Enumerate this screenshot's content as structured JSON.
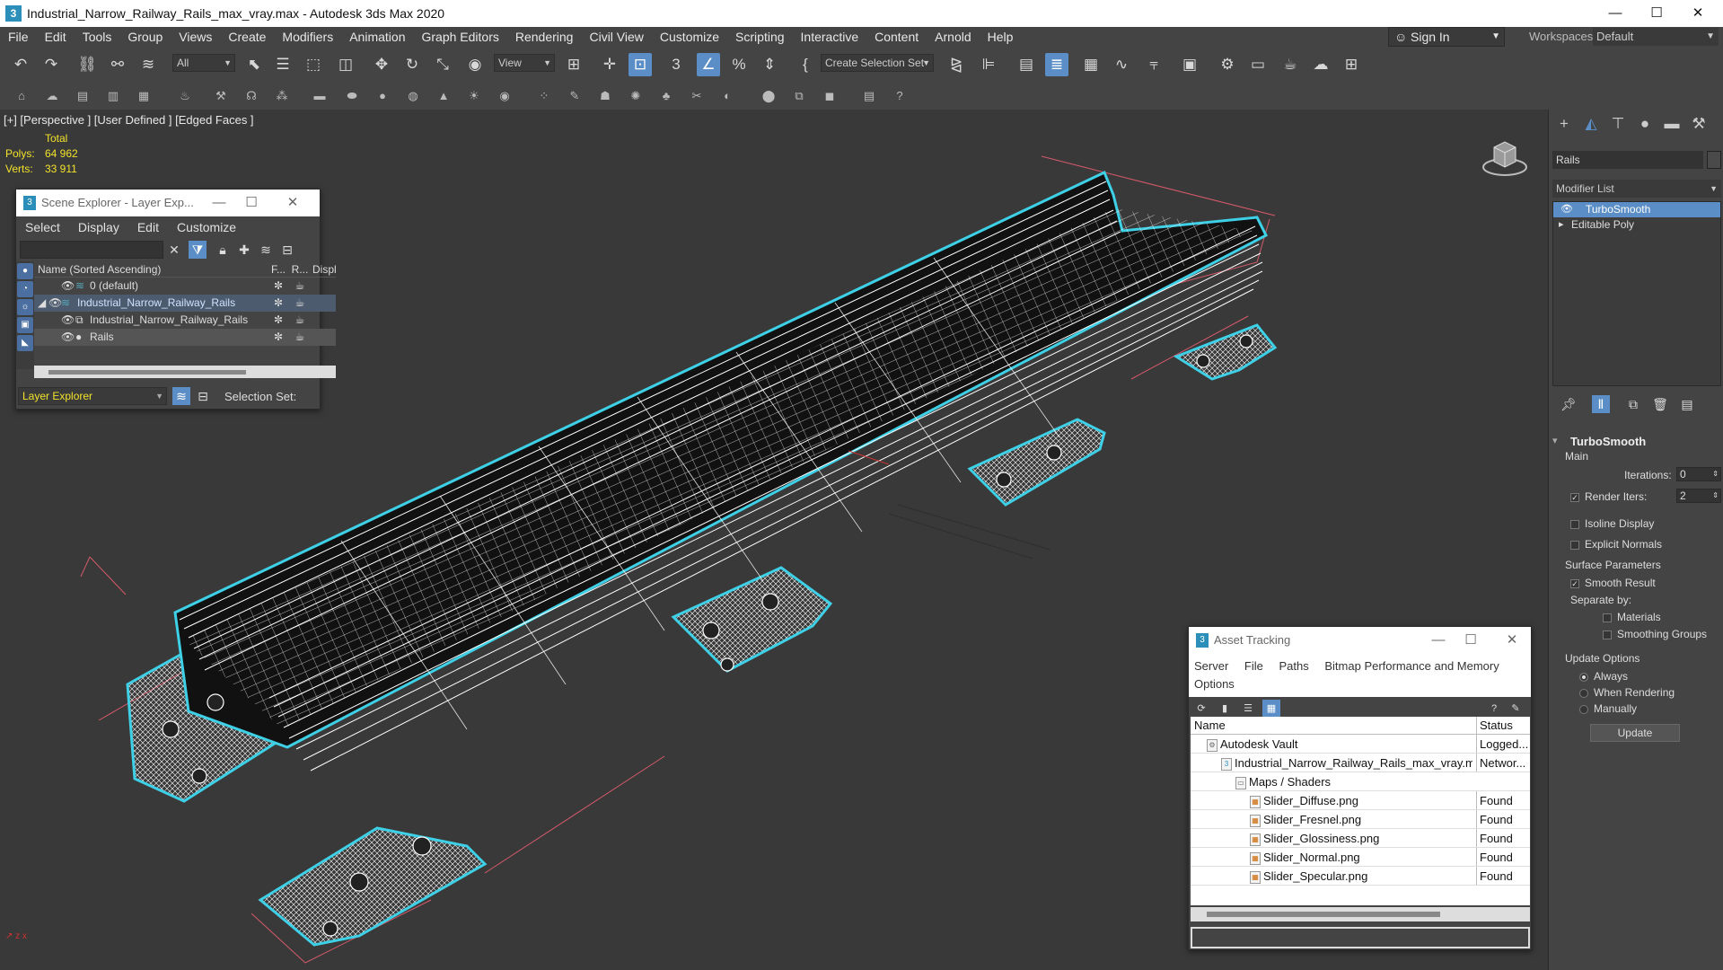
{
  "window": {
    "title": "Industrial_Narrow_Railway_Rails_max_vray.max - Autodesk 3ds Max 2020",
    "app_icon": "3"
  },
  "menu": [
    "File",
    "Edit",
    "Tools",
    "Group",
    "Views",
    "Create",
    "Modifiers",
    "Animation",
    "Graph Editors",
    "Rendering",
    "Civil View",
    "Customize",
    "Scripting",
    "Interactive",
    "Content",
    "Arnold",
    "Help"
  ],
  "account": {
    "signin": "Sign In",
    "workspaces_label": "Workspaces:",
    "workspace": "Default"
  },
  "toolbar": {
    "filter": "All",
    "view": "View",
    "selection_set": "Create Selection Set"
  },
  "viewport": {
    "label": "[+] [Perspective ] [User Defined ] [Edged Faces ]",
    "stats": {
      "total_label": "Total",
      "polys_label": "Polys:",
      "polys": "64 962",
      "verts_label": "Verts:",
      "verts": "33 911"
    }
  },
  "scene_explorer": {
    "title": "Scene Explorer - Layer Exp...",
    "menu": [
      "Select",
      "Display",
      "Edit",
      "Customize"
    ],
    "header": {
      "name": "Name (Sorted Ascending)",
      "c2": "F...",
      "c3": "R...",
      "c4": "Displ"
    },
    "rows": [
      "0 (default)",
      "Industrial_Narrow_Railway_Rails",
      "Industrial_Narrow_Railway_Rails",
      "Rails"
    ],
    "footer_dropdown": "Layer Explorer",
    "footer_label": "Selection Set:"
  },
  "command_panel": {
    "object_name": "Rails",
    "modifier_list": "Modifier List",
    "stack": [
      "TurboSmooth",
      "Editable Poly"
    ],
    "rollout": "TurboSmooth",
    "main_label": "Main",
    "iterations_label": "Iterations:",
    "iterations": "0",
    "render_iters_label": "Render Iters:",
    "render_iters": "2",
    "isoline": "Isoline Display",
    "explicit_normals": "Explicit Normals",
    "surface_params": "Surface Parameters",
    "smooth_result": "Smooth Result",
    "separate_by": "Separate by:",
    "materials": "Materials",
    "smoothing_groups": "Smoothing Groups",
    "update_options": "Update Options",
    "always": "Always",
    "when_rendering": "When Rendering",
    "manually": "Manually",
    "update_btn": "Update"
  },
  "asset_tracking": {
    "title": "Asset Tracking",
    "menu": [
      "Server",
      "File",
      "Paths",
      "Bitmap Performance and Memory",
      "Options"
    ],
    "header": {
      "name": "Name",
      "status": "Status"
    },
    "rows": [
      {
        "name": "Autodesk Vault",
        "status": "Logged..."
      },
      {
        "name": "Industrial_Narrow_Railway_Rails_max_vray.max",
        "status": "Networ..."
      },
      {
        "name": "Maps / Shaders",
        "status": ""
      },
      {
        "name": "Slider_Diffuse.png",
        "status": "Found"
      },
      {
        "name": "Slider_Fresnel.png",
        "status": "Found"
      },
      {
        "name": "Slider_Glossiness.png",
        "status": "Found"
      },
      {
        "name": "Slider_Normal.png",
        "status": "Found"
      },
      {
        "name": "Slider_Specular.png",
        "status": "Found"
      }
    ]
  },
  "colors": {
    "accent": "#5b8ec6",
    "wire": "#ffffff",
    "selection_outline": "#3ed0e6",
    "bbox": "#d45a6a",
    "stats": "#f2e22b"
  }
}
